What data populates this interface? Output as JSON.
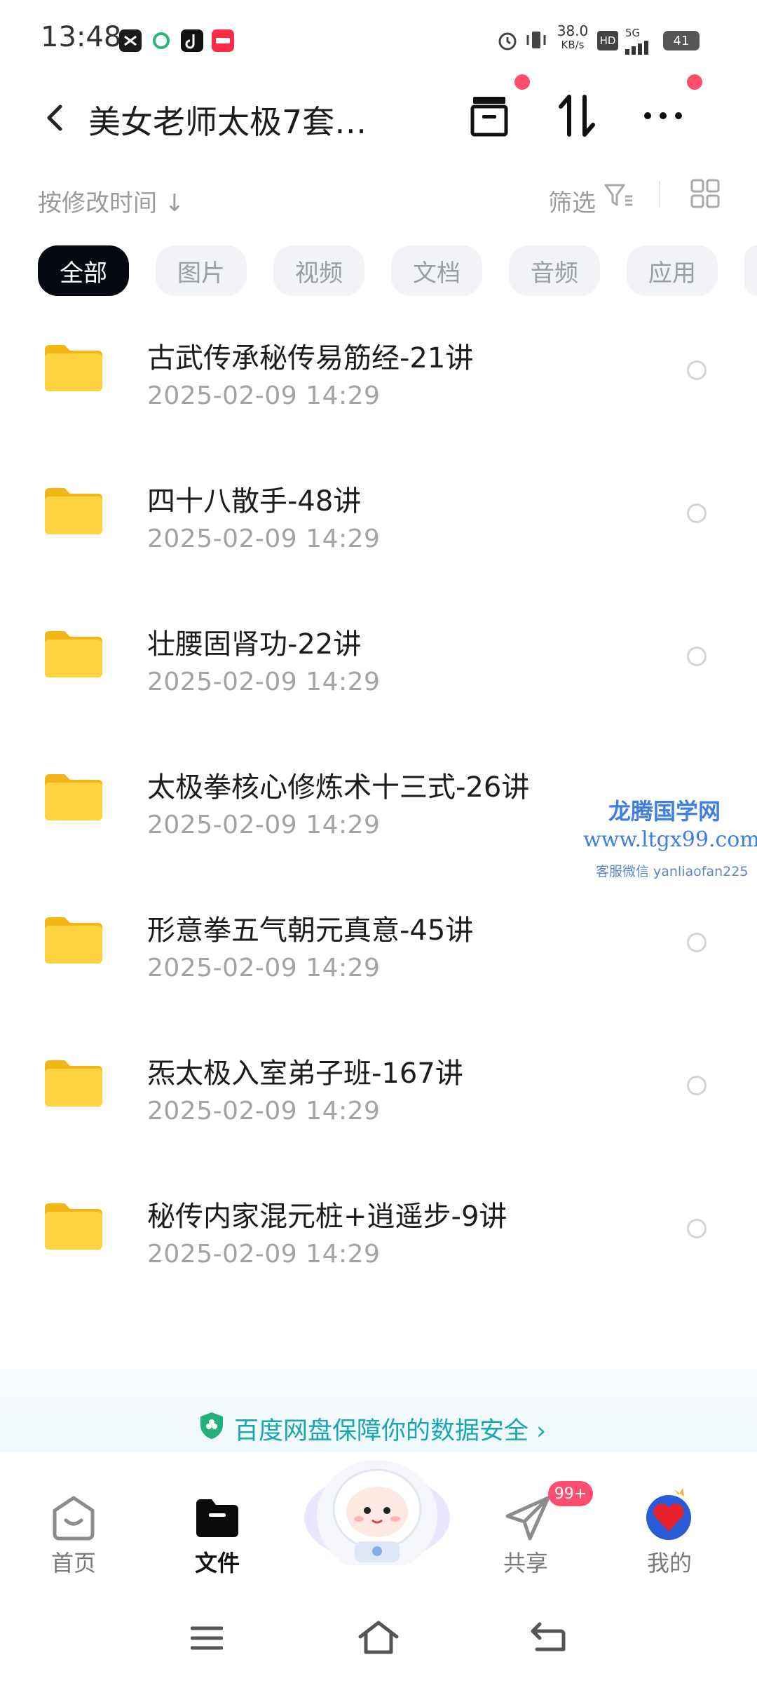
{
  "status_bar": {
    "time": "13:48",
    "speed": "38.0",
    "speed_unit": "KB/s",
    "hd": "HD",
    "network": "5G",
    "battery": "41"
  },
  "header": {
    "title": "美女老师太极7套…",
    "back_icon": "back-arrow-icon",
    "icons": [
      "archive-icon",
      "sort-transfer-icon",
      "more-icon"
    ]
  },
  "sort_row": {
    "sort_label": "按修改时间 ↓",
    "filter_label": "筛选"
  },
  "chips": [
    {
      "label": "全部",
      "active": true
    },
    {
      "label": "图片",
      "active": false
    },
    {
      "label": "视频",
      "active": false
    },
    {
      "label": "文档",
      "active": false
    },
    {
      "label": "音频",
      "active": false
    },
    {
      "label": "应用",
      "active": false
    }
  ],
  "files": [
    {
      "name": "古武传承秘传易筋经-21讲",
      "date": "2025-02-09  14:29"
    },
    {
      "name": "四十八散手-48讲",
      "date": "2025-02-09  14:29"
    },
    {
      "name": "壮腰固肾功-22讲",
      "date": "2025-02-09  14:29"
    },
    {
      "name": "太极拳核心修炼术十三式-26讲",
      "date": "2025-02-09  14:29"
    },
    {
      "name": "形意拳五气朝元真意-45讲",
      "date": "2025-02-09  14:29"
    },
    {
      "name": "炁太极入室弟子班-167讲",
      "date": "2025-02-09  14:29"
    },
    {
      "name": "秘传内家混元桩+逍遥步-9讲",
      "date": "2025-02-09  14:29"
    }
  ],
  "watermark": {
    "line1": "龙腾国学网",
    "line2": "www.ltgx99.com",
    "line3": "客服微信 yanliaofan225"
  },
  "banner": {
    "text": "百度网盘保障你的数据安全 ›"
  },
  "bottom_nav": {
    "items": [
      {
        "label": "首页"
      },
      {
        "label": "文件"
      },
      {
        "label": "共享"
      },
      {
        "label": "我的"
      }
    ],
    "share_badge": "99+"
  },
  "colors": {
    "accent": "#06090f",
    "folder": "#ffcc33",
    "banner_text": "#17a6b2",
    "badge": "#ff4d70"
  }
}
